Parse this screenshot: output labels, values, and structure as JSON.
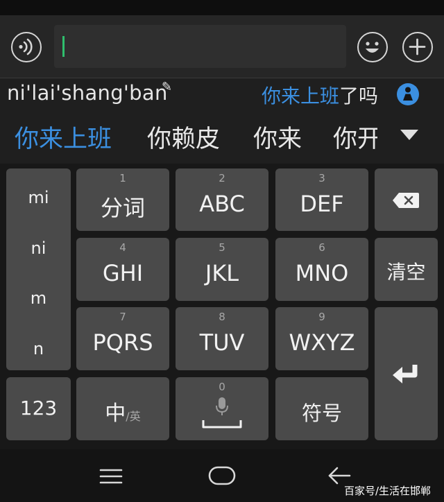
{
  "input_bar": {
    "voice_icon": "voice-wave-icon",
    "emoji_icon": "smiley-icon",
    "plus_icon": "plus-icon",
    "text_value": ""
  },
  "pinyin": {
    "text": "ni'lai'shang'ban",
    "edit_icon": "pencil-icon",
    "prediction_highlight": "你来上班",
    "prediction_rest": "了吗",
    "assist_icon": "blue-person-icon"
  },
  "candidates": {
    "items": [
      "你来上班",
      "你赖皮",
      "你来",
      "你开"
    ],
    "expand_icon": "triangle-down-icon"
  },
  "keyboard": {
    "side_items": [
      "mi",
      "ni",
      "m",
      "n"
    ],
    "keys": [
      {
        "num": "1",
        "label": "分词"
      },
      {
        "num": "2",
        "label": "ABC"
      },
      {
        "num": "3",
        "label": "DEF"
      },
      {
        "num": "4",
        "label": "GHI"
      },
      {
        "num": "5",
        "label": "JKL"
      },
      {
        "num": "6",
        "label": "MNO"
      },
      {
        "num": "7",
        "label": "PQRS"
      },
      {
        "num": "8",
        "label": "TUV"
      },
      {
        "num": "9",
        "label": "WXYZ"
      }
    ],
    "backspace_icon": "backspace-icon",
    "clear_label": "清空",
    "enter_icon": "enter-return-icon",
    "num_label": "123",
    "lang_main": "中",
    "lang_sub": "/英",
    "space_num": "0",
    "mic_icon": "microphone-icon",
    "symbol_label": "符号"
  },
  "navbar": {
    "menu_icon": "menu-lines-icon",
    "home_icon": "home-pill-icon",
    "back_icon": "back-arrow-icon"
  },
  "watermark": "百家号/生活在邯郸",
  "colors": {
    "accent": "#3b8fe0",
    "caret": "#2fbf6d",
    "key": "#4a4a4a",
    "background": "#181818"
  }
}
